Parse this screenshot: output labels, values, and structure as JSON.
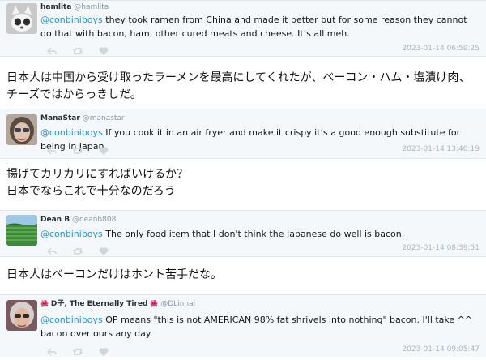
{
  "tweets": [
    {
      "name": "hamlita",
      "handle": "@hamlita",
      "mention": "@conbiniboys",
      "text": " they took ramen from China and made it better but for some reason they cannot do that with bacon, ham, other cured meats and cheese. It’s all meh.",
      "timestamp": "2023-01-14 06:59:25"
    },
    {
      "name": "ManaStar",
      "handle": "@manastar",
      "mention": "@conbiniboys",
      "text": " If you cook it in an air fryer and make it crispy it’s a good enough substitute for being in Japan",
      "timestamp": "2023-01-14 13:40:19"
    },
    {
      "name": "Dean B",
      "handle": "@deanb808",
      "mention": "@conbiniboys",
      "text": " The only food item that I don't think the Japanese do well is bacon.",
      "timestamp": "2023-01-14 08:39:51"
    },
    {
      "name": "D子, The Eternally Tired",
      "name_emoji": "🌺",
      "handle": "@DLinnai",
      "mention": "@conbiniboys",
      "text": " OP means \"this is not AMERICAN 98% fat shrivels into nothing\" bacon. I'll take ^^ bacon over ours any day.",
      "timestamp": "2023-01-14 09:05:47"
    }
  ],
  "translations": [
    "日本人は中国から受け取ったラーメンを最高にしてくれたが、ベーコン・ハム・塩漬け肉、チーズではからっきしだ。",
    "揚げてカリカリにすればいけるか？\n日本でならこれで十分なのだろう",
    "日本人はベーコンだけはホント苦手だな。"
  ],
  "colors": {
    "mention": "#1b95e0",
    "tweet_bg": "#f5f8fa",
    "timestamp": "#aab8c2",
    "icon": "#ccd6dd"
  },
  "icons": [
    "reply-icon",
    "retweet-icon",
    "like-icon"
  ]
}
